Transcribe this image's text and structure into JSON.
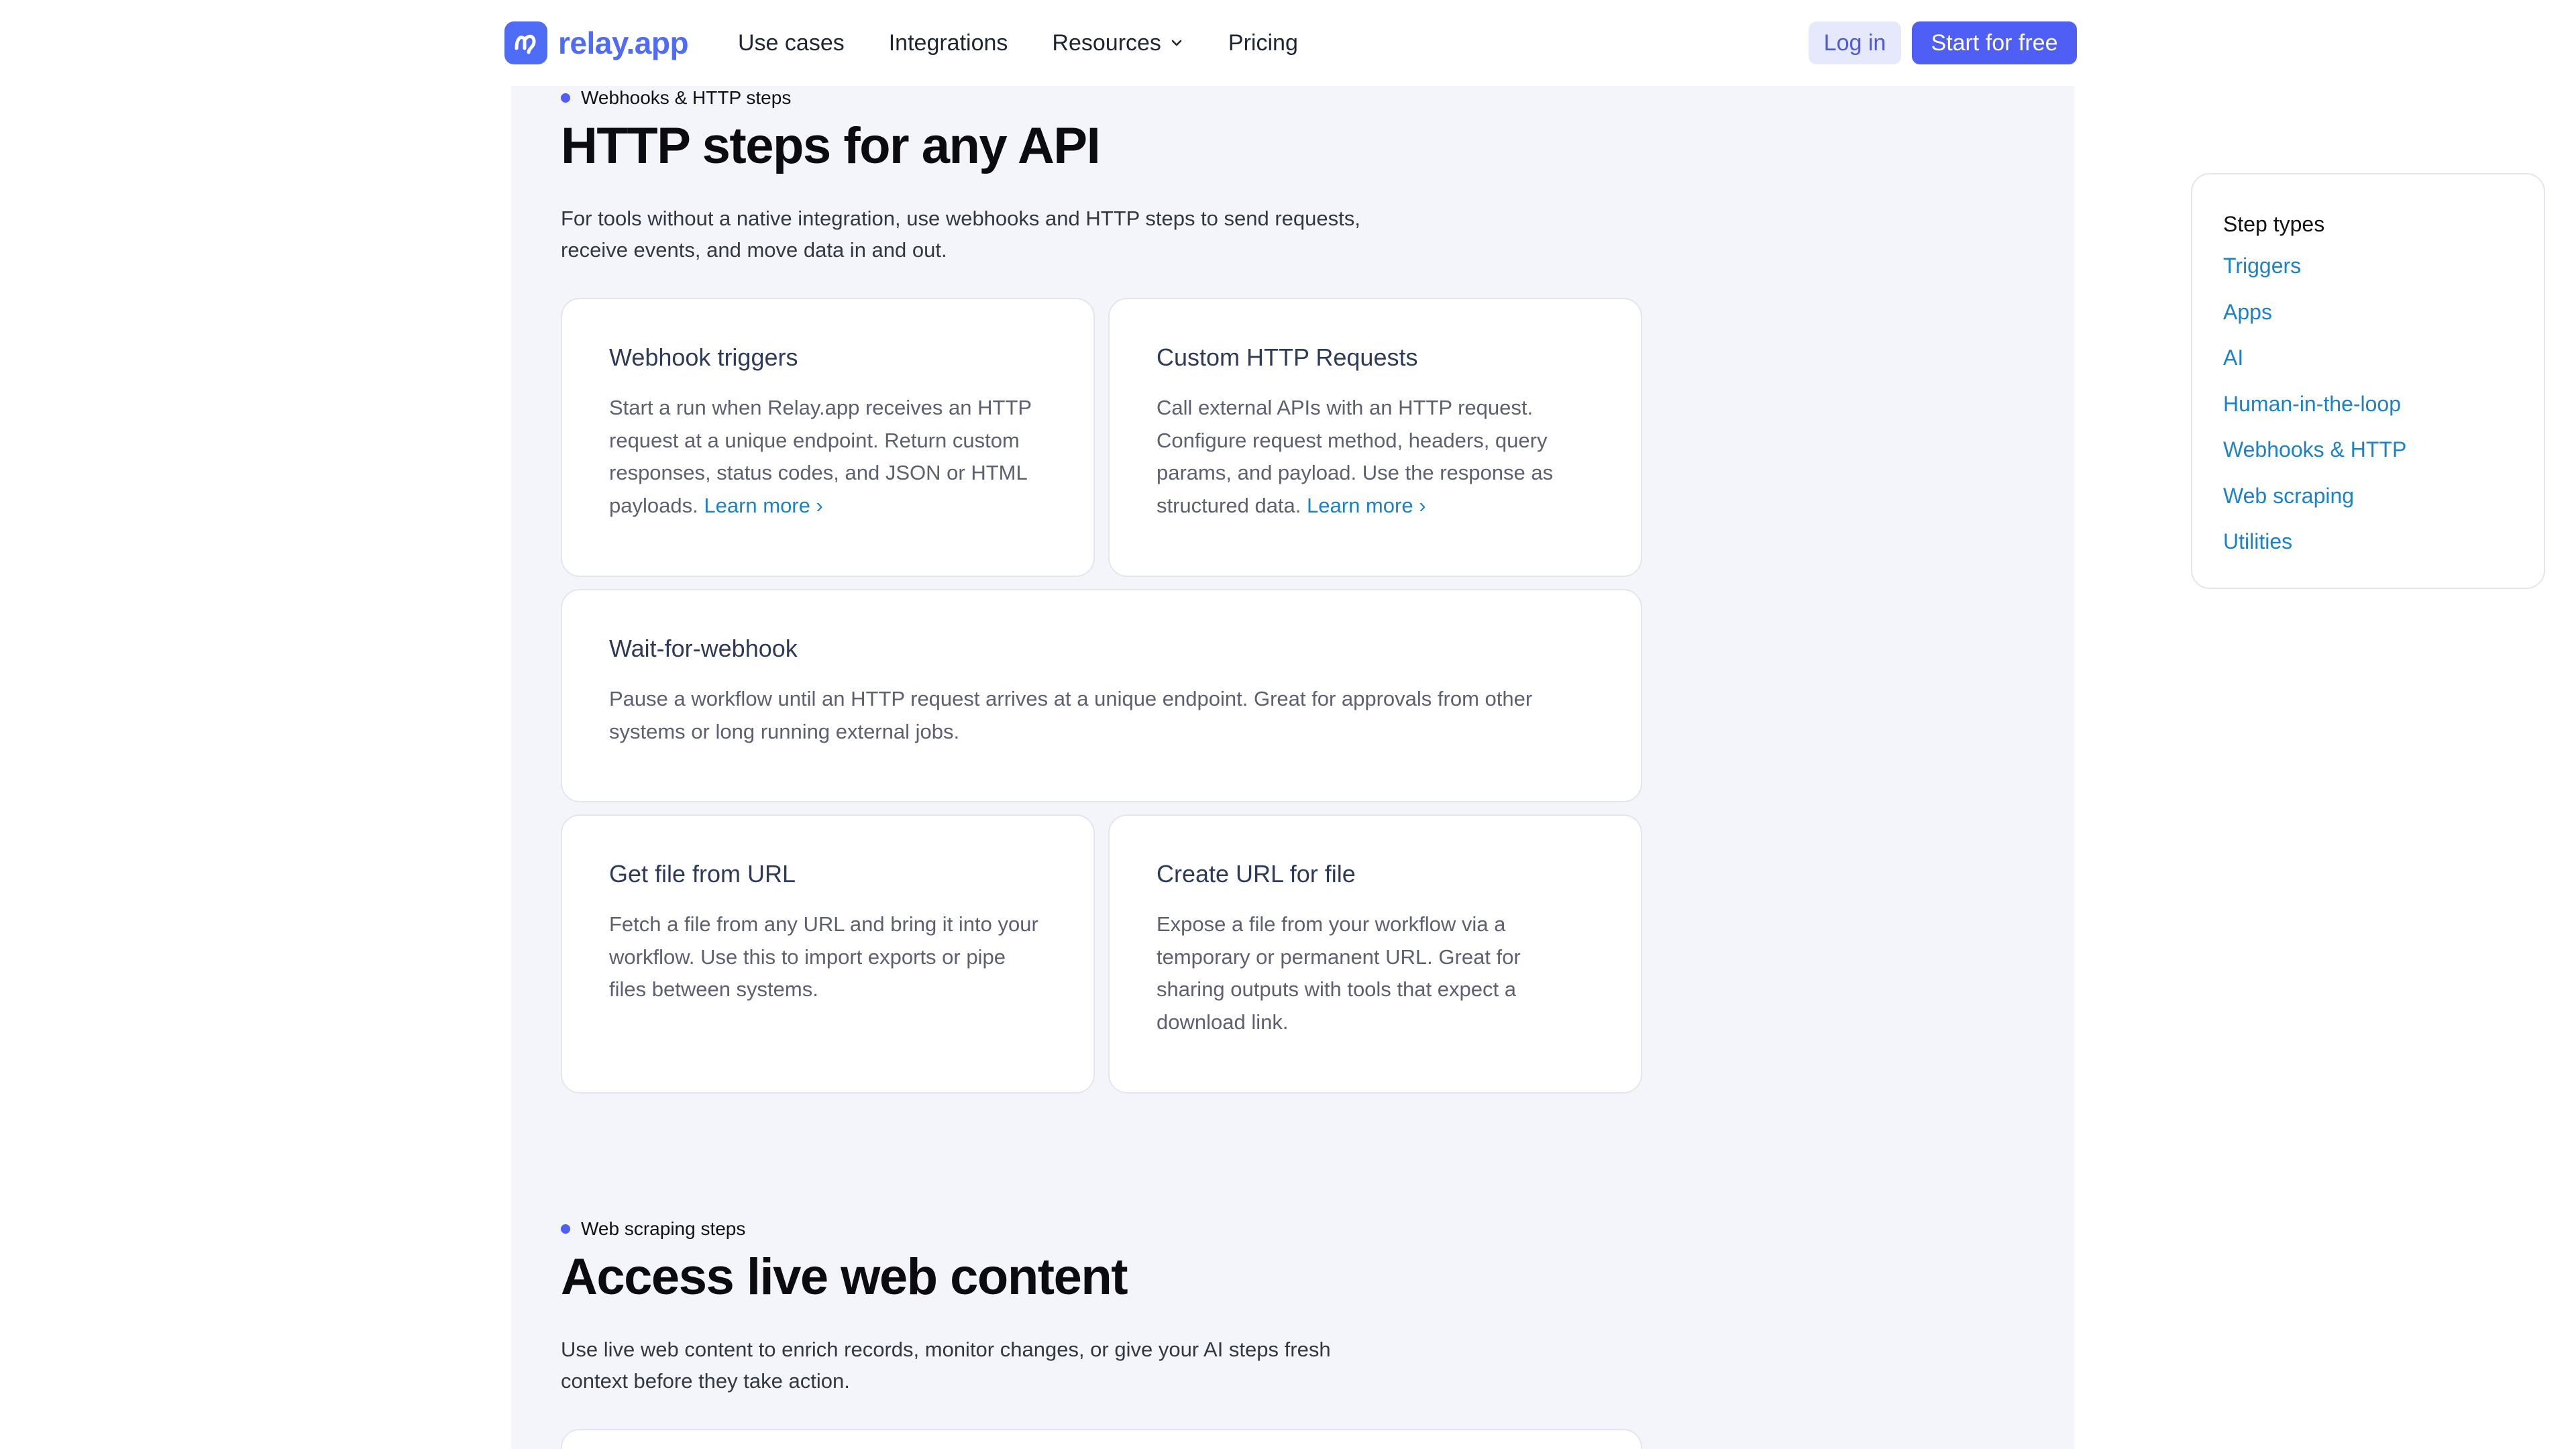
{
  "header": {
    "brand": "relay.app",
    "nav": [
      "Use cases",
      "Integrations",
      "Resources",
      "Pricing"
    ],
    "login_label": "Log in",
    "start_label": "Start for free"
  },
  "sections": [
    {
      "eyebrow": "Webhooks & HTTP steps",
      "title": "HTTP steps for any API",
      "description": "For tools without a native integration, use webhooks and HTTP steps to send requests, receive events, and move data in and out.",
      "cards": [
        {
          "title": "Webhook triggers",
          "body": "Start a run when Relay.app receives an HTTP request at a unique endpoint. Return custom responses, status codes, and JSON or HTML payloads.",
          "link": "Learn more ›"
        },
        {
          "title": "Custom HTTP Requests",
          "body": "Call external APIs with an HTTP request. Configure request method, headers, query params, and payload. Use the response as structured data.",
          "link": "Learn more ›"
        },
        {
          "title": "Wait-for-webhook",
          "body": "Pause a workflow until an HTTP request arrives at a unique endpoint. Great for approvals from other systems or long running external jobs."
        },
        {
          "title": "Get file from URL",
          "body": "Fetch a file from any URL and bring it into your workflow. Use this to import exports or pipe files between systems."
        },
        {
          "title": "Create URL for file",
          "body": "Expose a file from your workflow via a temporary or permanent URL. Great for sharing outputs with tools that expect a download link."
        }
      ]
    },
    {
      "eyebrow": "Web scraping steps",
      "title": "Access live web content",
      "description": "Use live web content to enrich records, monitor changes, or give your AI steps fresh context before they take action."
    }
  ],
  "sidebar": {
    "title": "Step types",
    "items": [
      "Triggers",
      "Apps",
      "AI",
      "Human-in-the-loop",
      "Webhooks & HTTP",
      "Web scraping",
      "Utilities"
    ]
  },
  "colors": {
    "accent": "#4f5ef5",
    "link": "#1b82c9",
    "band_background": "#f4f5fa"
  }
}
